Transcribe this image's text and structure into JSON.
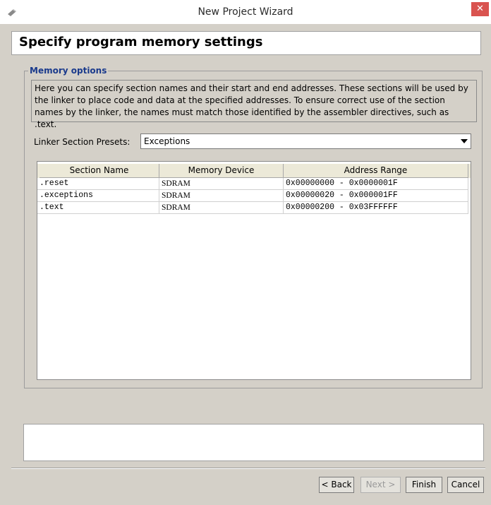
{
  "window": {
    "title": "New Project Wizard",
    "close_label": "✕"
  },
  "header": {
    "title": "Specify program memory settings"
  },
  "memory_options": {
    "legend": "Memory options",
    "description": "Here you can specify section names and their start and end addresses. These sections will be used by the linker to place code and data at the specified addresses. To ensure correct use of the section names by the linker, the names must match those identified by the assembler directives, such as .text."
  },
  "presets": {
    "label": "Linker Section Presets:",
    "selected": "Exceptions"
  },
  "table": {
    "columns": [
      "Section Name",
      "Memory Device",
      "Address Range"
    ],
    "rows": [
      {
        "section": ".reset",
        "device": "SDRAM",
        "range": "0x00000000 - 0x0000001F"
      },
      {
        "section": ".exceptions",
        "device": "SDRAM",
        "range": "0x00000020 - 0x000001FF"
      },
      {
        "section": ".text",
        "device": "SDRAM",
        "range": "0x00000200 - 0x03FFFFFF"
      }
    ]
  },
  "buttons": {
    "back": "< Back",
    "next": "Next >",
    "finish": "Finish",
    "cancel": "Cancel",
    "next_enabled": false
  },
  "colors": {
    "close_button": "#d9534f",
    "legend_text": "#1a3a8c",
    "window_bg": "#d4d0c8"
  },
  "icons": {
    "app": "wizard-app-icon",
    "dropdown": "chevron-down-icon",
    "close": "close-icon"
  }
}
